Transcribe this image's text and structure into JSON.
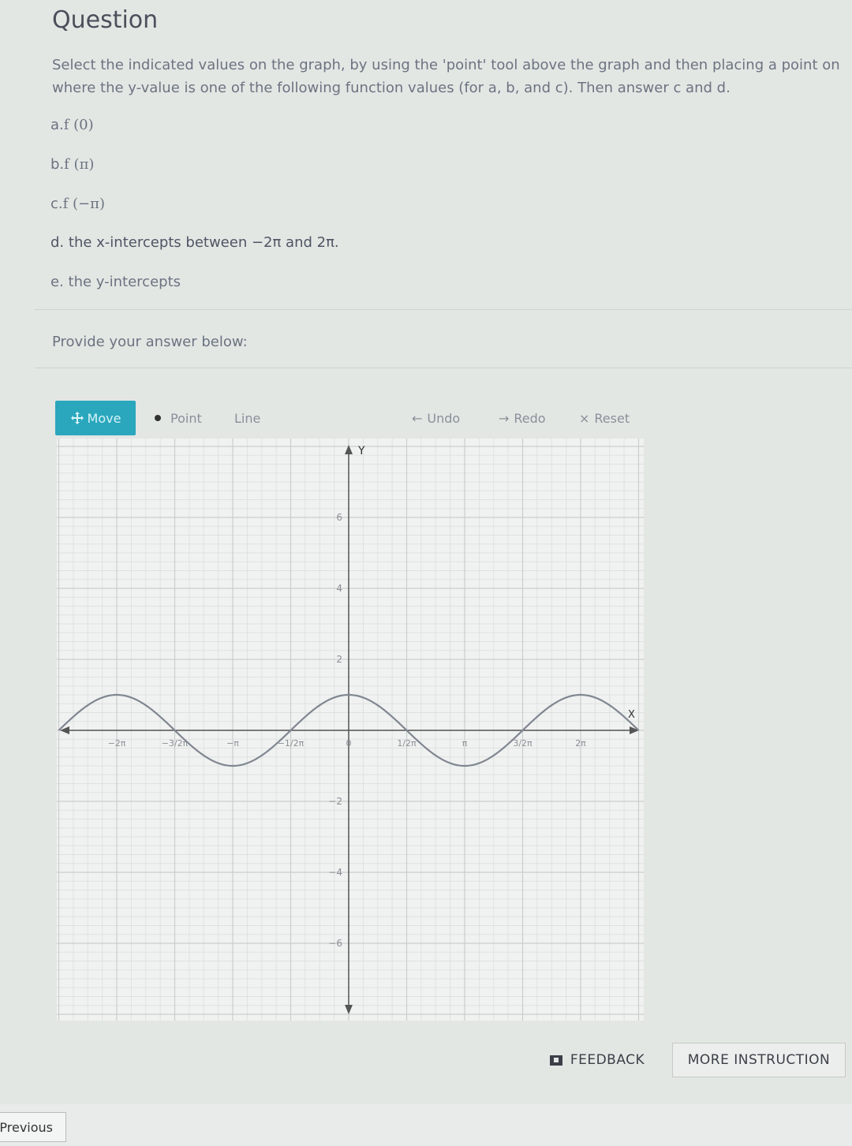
{
  "question": {
    "title": "Question",
    "instruction": "Select the indicated values on the graph, by using the 'point' tool above the graph and then placing a point on where the y-value is one of the following function values (for a, b, and c). Then answer c and d.",
    "parts": [
      {
        "label": "a.",
        "text": "f (0)"
      },
      {
        "label": "b.",
        "text": "f (π)"
      },
      {
        "label": "c.",
        "text": "f (−π)"
      },
      {
        "label": "d.",
        "text": "the x-intercepts between −2π and 2π."
      },
      {
        "label": "e.",
        "text": "the y-intercepts"
      }
    ],
    "provide_label": "Provide your answer below:"
  },
  "toolbar": {
    "move": "Move",
    "point": "Point",
    "line": "Line",
    "undo": "Undo",
    "redo": "Redo",
    "reset": "Reset"
  },
  "graph": {
    "axis_x_label": "X",
    "axis_y_label": "Y",
    "x_tick_labels": [
      "−2π",
      "−3/2π",
      "−π",
      "−1/2π",
      "0",
      "1/2π",
      "π",
      "3/2π",
      "2π"
    ],
    "y_tick_labels": [
      "6",
      "4",
      "2",
      "−2",
      "−4",
      "−6"
    ],
    "curve": {
      "function": "cos(x)",
      "amplitude": 1,
      "x_range_pi": [
        -2.5,
        2.5
      ]
    }
  },
  "chart_data": {
    "type": "line",
    "x_domain": [
      -7.85,
      7.85
    ],
    "ylim": [
      -7.5,
      7.5
    ],
    "x_ticks_pi": [
      -2,
      -1.5,
      -1,
      -0.5,
      0,
      0.5,
      1,
      1.5,
      2
    ],
    "y_ticks": [
      6,
      4,
      2,
      -2,
      -4,
      -6
    ],
    "series": [
      {
        "function": "cos(x)",
        "sample_points": [
          [
            -6.283,
            1
          ],
          [
            -4.712,
            0
          ],
          [
            -3.142,
            -1
          ],
          [
            -1.571,
            0
          ],
          [
            0,
            1
          ],
          [
            1.571,
            0
          ],
          [
            3.142,
            -1
          ],
          [
            4.712,
            0
          ],
          [
            6.283,
            1
          ]
        ]
      }
    ],
    "grid": true
  },
  "buttons": {
    "feedback": "FEEDBACK",
    "more_instruction": "MORE INSTRUCTION",
    "previous": "Previous"
  }
}
